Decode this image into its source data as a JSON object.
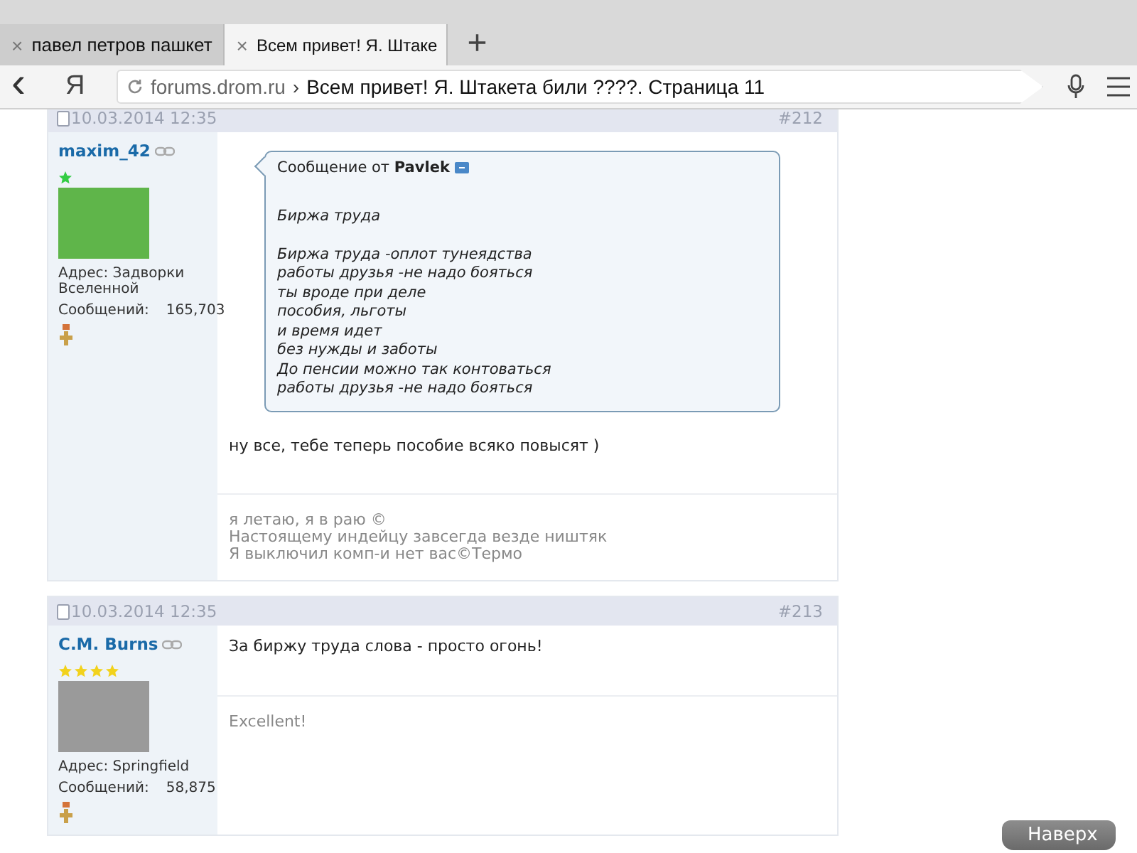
{
  "tabs": [
    {
      "title": "павел петров пашкет",
      "close": "×",
      "selected": false
    },
    {
      "title": "Всем привет! Я. Штаке",
      "close": "×",
      "selected": true
    }
  ],
  "new_tab": "+",
  "toolbar": {
    "back": "‹",
    "logo": "Я",
    "address": {
      "host": "forums.drom.ru",
      "separator": "›",
      "title": "Всем привет! Я. Штакета били ????. Страница 11"
    }
  },
  "posts": [
    {
      "date": "10.03.2014 12:35",
      "number": "#212",
      "user": "maxim_42",
      "rank": {
        "kind": "badge",
        "color": "#33cc44"
      },
      "address": "Адрес: Задворки Вселенной",
      "posts_label": "Сообщений:",
      "posts_count": "165,703",
      "quote": {
        "header": "Сообщение от **Pavlek**",
        "title": "Биржа труда",
        "lines": [
          "Биржа труда -оплот тунеядства",
          "работы друзья -не надо бояться",
          "ты вроде при деле",
          "пособия, льготы",
          "и время идет",
          "без нужды и заботы",
          "До пенсии можно так контоваться",
          "работы друзья -не надо бояться"
        ]
      },
      "message": "ну все, тебе теперь пособие всяко повысят )",
      "signature": [
        "я летаю, я в раю ©",
        "Настоящему индейцу завсегда везде ништяк",
        "Я выключил комп-и нет вас©Термо"
      ]
    },
    {
      "date": "10.03.2014 12:35",
      "number": "#213",
      "user": "C.M. Burns",
      "rank": {
        "kind": "stars",
        "stars": 4,
        "color": "#f2d21c"
      },
      "address": "Адрес: Springfield",
      "posts_label": "Сообщений:",
      "posts_count": "58,875",
      "message": "За биржу труда слова - просто огонь!",
      "signature": [
        "Excellent!"
      ]
    }
  ],
  "scroll_top_button": "Наверх"
}
